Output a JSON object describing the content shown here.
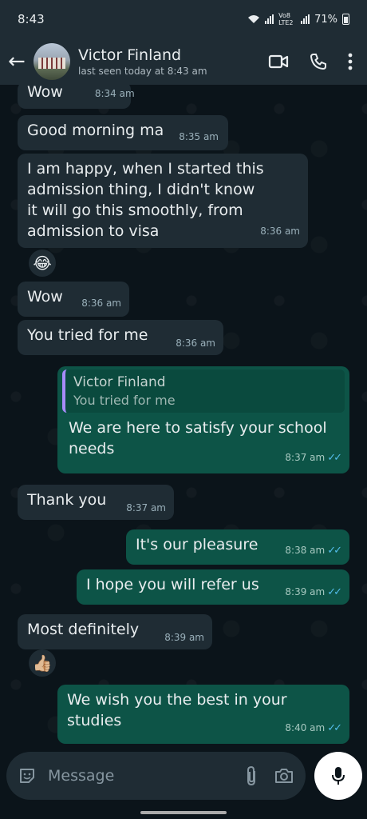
{
  "status_bar": {
    "time": "8:43",
    "network": "Vo8 LTE2",
    "battery": "71%"
  },
  "header": {
    "contact_name": "Victor Finland",
    "last_seen": "last seen today at 8:43 am"
  },
  "messages": [
    {
      "dir": "in",
      "text": "Wow",
      "time": "8:34 am"
    },
    {
      "dir": "in",
      "text": "Good morning ma",
      "time": "8:35 am"
    },
    {
      "dir": "in",
      "text": "I am happy, when I started this admission thing, I didn't know it will go this smoothly, from admission to visa",
      "time": "8:36 am"
    },
    {
      "dir": "in",
      "emoji": "😂"
    },
    {
      "dir": "in",
      "text": "Wow",
      "time": "8:36 am"
    },
    {
      "dir": "in",
      "text": "You tried for me",
      "time": "8:36 am"
    },
    {
      "dir": "out",
      "quote_name": "Victor Finland",
      "quote_text": "You tried for me",
      "text": "We are here to satisfy your school needs",
      "time": "8:37 am"
    },
    {
      "dir": "in",
      "text": "Thank you",
      "time": "8:37 am"
    },
    {
      "dir": "out",
      "text": "It's our pleasure",
      "time": "8:38 am"
    },
    {
      "dir": "out",
      "text": "I hope you will refer us",
      "time": "8:39 am"
    },
    {
      "dir": "in",
      "text": "Most definitely",
      "time": "8:39 am"
    },
    {
      "dir": "in",
      "emoji": "👍🏼"
    },
    {
      "dir": "out",
      "text": "We wish you the best in your studies",
      "time": "8:40 am"
    }
  ],
  "composer": {
    "placeholder": "Message"
  },
  "colors": {
    "incoming": "#1f2c34",
    "outgoing": "#0d5447",
    "read_ticks": "#53bdeb",
    "background": "#0b141a"
  }
}
